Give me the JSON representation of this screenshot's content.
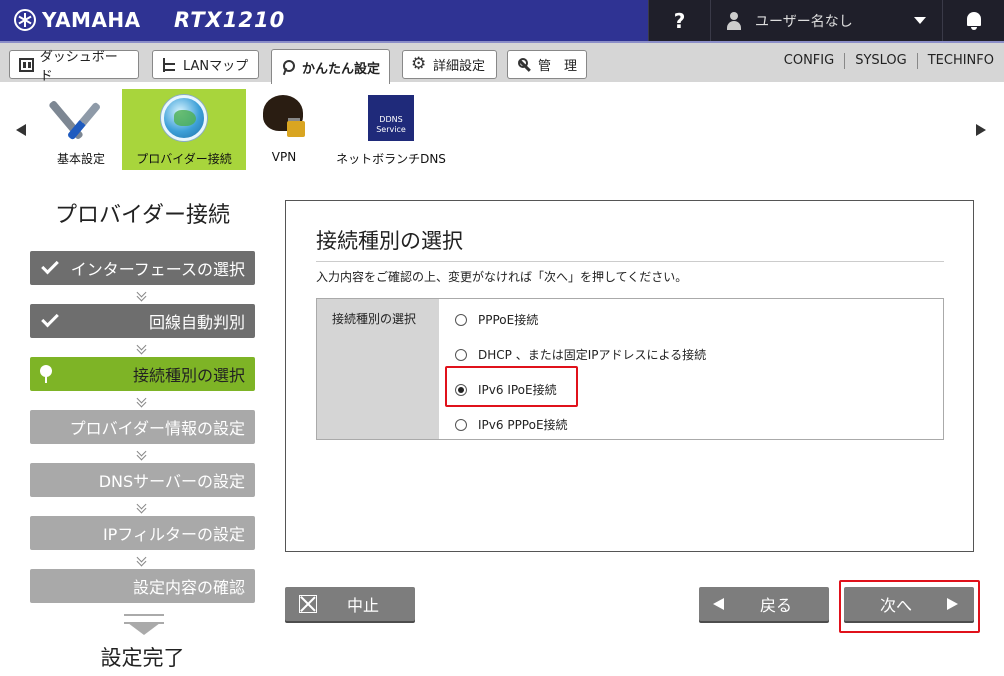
{
  "header": {
    "brand": "YAMAHA",
    "model": "RTX1210",
    "help": "?",
    "user": "ユーザー名なし"
  },
  "tabs": [
    {
      "label": "ダッシュボード",
      "icon": "dashboard-icon"
    },
    {
      "label": "LANマップ",
      "icon": "lan-map-icon"
    },
    {
      "label": "かんたん設定",
      "icon": "easy-setup-icon"
    },
    {
      "label": "詳細設定",
      "icon": "gear-icon"
    },
    {
      "label": "管　理",
      "icon": "wrench-icon"
    }
  ],
  "top_links": [
    "CONFIG",
    "SYSLOG",
    "TECHINFO"
  ],
  "carousel": [
    {
      "label": "基本設定",
      "icon": "tools-icon"
    },
    {
      "label": "プロバイダー接続",
      "icon": "globe-icon"
    },
    {
      "label": "VPN",
      "icon": "vpn-lock-icon"
    },
    {
      "label": "ネットボランチDNS",
      "icon": "ddns-service-icon"
    }
  ],
  "ddns_icon_text": "DDNS Service",
  "steps": {
    "title": "プロバイダー接続",
    "items": [
      "インターフェースの選択",
      "回線自動判別",
      "接続種別の選択",
      "プロバイダー情報の設定",
      "DNSサーバーの設定",
      "IPフィルターの設定",
      "設定内容の確認"
    ],
    "finish": "設定完了"
  },
  "panel": {
    "title": "接続種別の選択",
    "description": "入力内容をご確認の上、変更がなければ「次へ」を押してください。",
    "field_label": "接続種別の選択",
    "options": [
      "PPPoE接続",
      "DHCP 、または固定IPアドレスによる接続",
      "IPv6 IPoE接続",
      "IPv6 PPPoE接続"
    ],
    "selected": "IPv6 IPoE接続"
  },
  "buttons": {
    "cancel": "中止",
    "back": "戻る",
    "next": "次へ"
  },
  "colors": {
    "header_bg": "#2f3393",
    "accent_green": "#7eb426",
    "highlight_red": "#e0111b"
  }
}
